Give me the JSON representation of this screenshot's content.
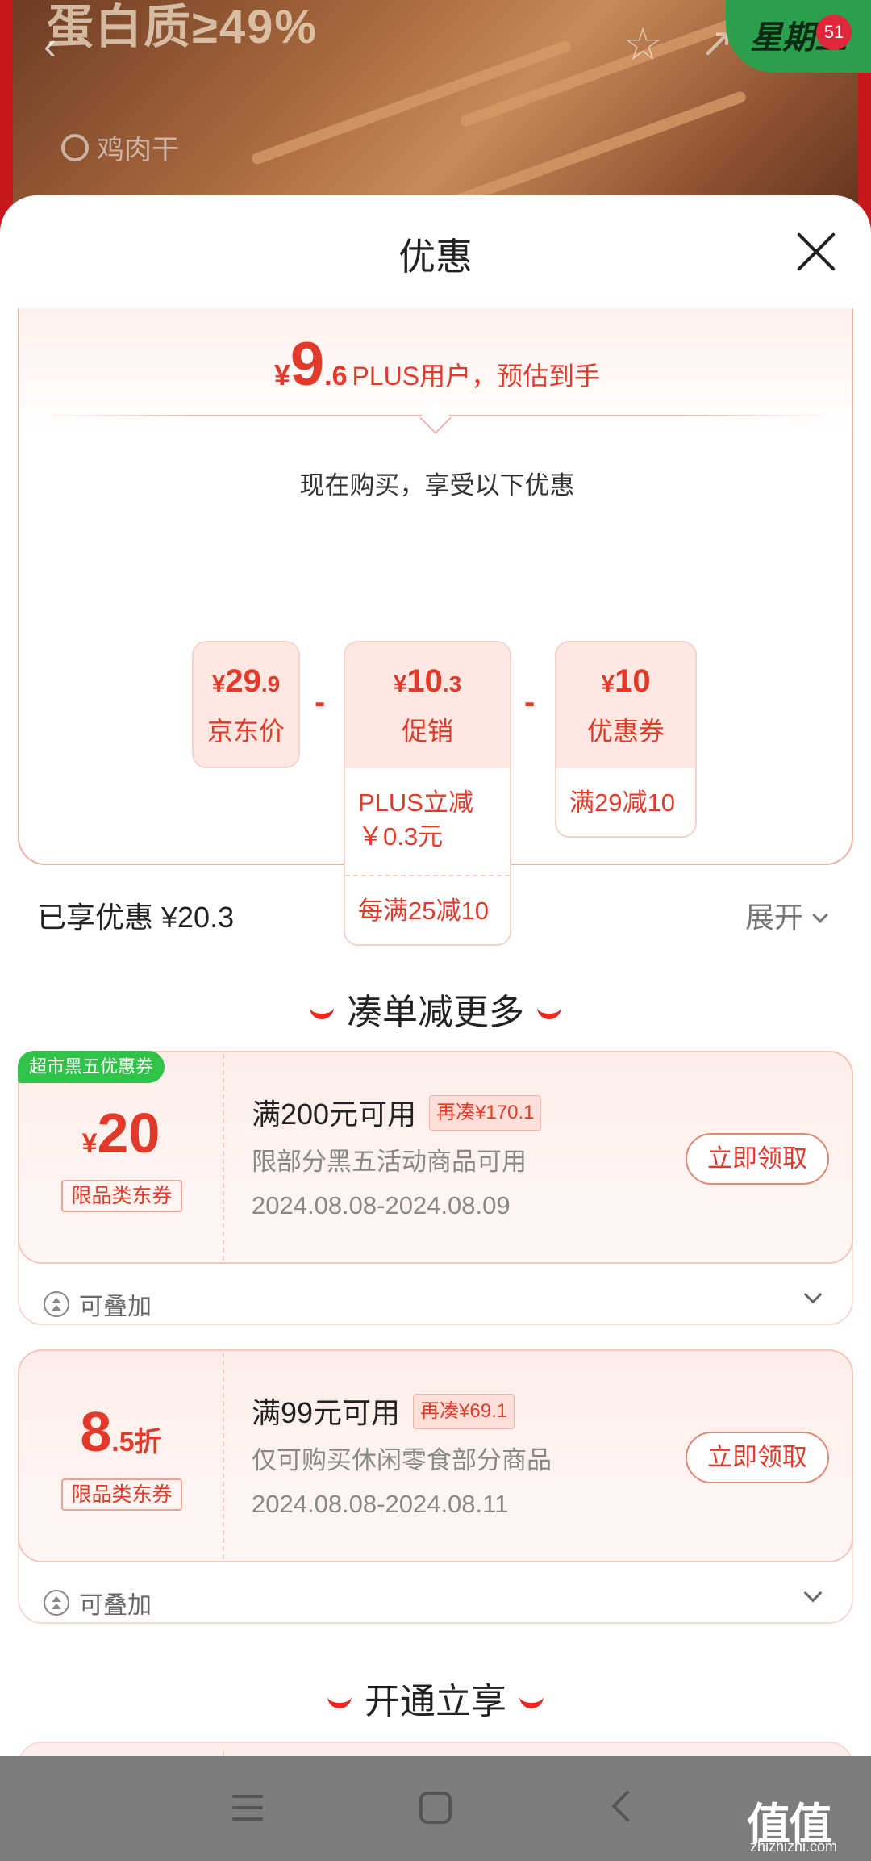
{
  "banner": {
    "headline": "蛋白质≥49%",
    "search_text": "鸡肉干",
    "badge_text": "星期五",
    "badge_count": "51"
  },
  "sheet": {
    "title": "优惠"
  },
  "estimate": {
    "currency": "¥",
    "int": "9",
    "dec": ".6",
    "note": "PLUS用户，预估到手"
  },
  "buy_line": "现在购买，享受以下优惠",
  "breakdown": {
    "jd_price": {
      "cur": "¥",
      "int": "29",
      "dec": ".9",
      "label": "京东价"
    },
    "promo": {
      "cur": "¥",
      "int": "10",
      "dec": ".3",
      "label": "促销",
      "rows": [
        "PLUS立减￥0.3元",
        "每满25减10"
      ]
    },
    "coupon": {
      "cur": "¥",
      "int": "10",
      "dec": "",
      "label": "优惠券",
      "rows": [
        "满29减10"
      ]
    },
    "minus": "-"
  },
  "savings": {
    "label": "已享优惠 ¥20.3",
    "expand": "展开"
  },
  "sections": {
    "more": "凑单减更多",
    "open": "开通立享"
  },
  "coupons": [
    {
      "tag": "超市黑五优惠券",
      "cur": "¥",
      "value": "20",
      "value_suffix": "",
      "type": "限品类东券",
      "title": "满200元可用",
      "add_more": "再凑¥170.1",
      "desc": "限部分黑五活动商品可用",
      "date": "2024.08.08-2024.08.09",
      "claim": "立即领取",
      "stack": "可叠加"
    },
    {
      "tag": "",
      "cur": "",
      "value": "8",
      "value_suffix": ".5折",
      "type": "限品类东券",
      "title": "满99元可用",
      "add_more": "再凑¥69.1",
      "desc": "仅可购买休闲零食部分商品",
      "date": "2024.08.08-2024.08.11",
      "claim": "立即领取",
      "stack": "可叠加"
    }
  ],
  "watermark": {
    "text": "值值值",
    "sub": "zhizhizhi.com"
  },
  "colors": {
    "accent": "#e23a2a",
    "tag_green": "#31c24a",
    "nav": "#7d7d7d"
  },
  "icons": [
    "back-icon",
    "star-icon",
    "share-icon",
    "search-icon",
    "close-icon",
    "chevron-down-icon",
    "stack-icon",
    "menu-icon",
    "home-icon",
    "nav-back-icon"
  ]
}
